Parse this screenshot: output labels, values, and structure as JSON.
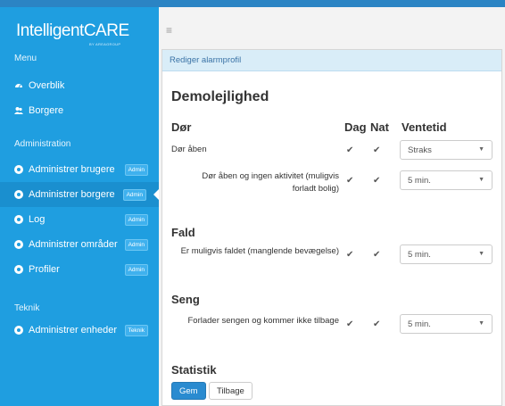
{
  "app": {
    "logo_main": "IntelligentCARE",
    "logo_sub": "BY AREAGROUP"
  },
  "sidebar": {
    "menu_header": "Menu",
    "menu_items": [
      {
        "label": "Overblik",
        "icon": "dashboard-icon"
      },
      {
        "label": "Borgere",
        "icon": "users-icon"
      }
    ],
    "admin_header": "Administration",
    "admin_items": [
      {
        "label": "Administrer brugere",
        "badge": "Admin"
      },
      {
        "label": "Administrer borgere",
        "badge": "Admin",
        "active": true
      },
      {
        "label": "Log",
        "badge": "Admin"
      },
      {
        "label": "Administrer områder",
        "badge": "Admin"
      },
      {
        "label": "Profiler",
        "badge": "Admin"
      }
    ],
    "tech_header": "Teknik",
    "tech_items": [
      {
        "label": "Administrer enheder",
        "badge": "Teknik"
      }
    ]
  },
  "topbar": {
    "menu_icon": "hamburger-icon"
  },
  "panel": {
    "header": "Rediger alarmprofil",
    "title": "Demolejlighed",
    "columns": {
      "dag": "Dag",
      "nat": "Nat",
      "ventetid": "Ventetid"
    },
    "groups": {
      "dor": "Dør",
      "fald": "Fald",
      "seng": "Seng",
      "statistik": "Statistik"
    },
    "rows": [
      {
        "label": "Dør åben",
        "dag": true,
        "nat": true,
        "ventetid": "Straks"
      },
      {
        "label": "Dør åben og ingen aktivitet (muligvis forladt bolig)",
        "dag": true,
        "nat": true,
        "ventetid": "5 min."
      },
      {
        "label": "Er muligvis faldet (manglende bevægelse)",
        "dag": true,
        "nat": true,
        "ventetid": "5 min."
      },
      {
        "label": "Forlader sengen og kommer ikke tilbage",
        "dag": true,
        "nat": true,
        "ventetid": "5 min."
      }
    ],
    "buttons": {
      "save": "Gem",
      "back": "Tilbage"
    },
    "check_glyph": "✔",
    "select_arrow": "▼"
  }
}
